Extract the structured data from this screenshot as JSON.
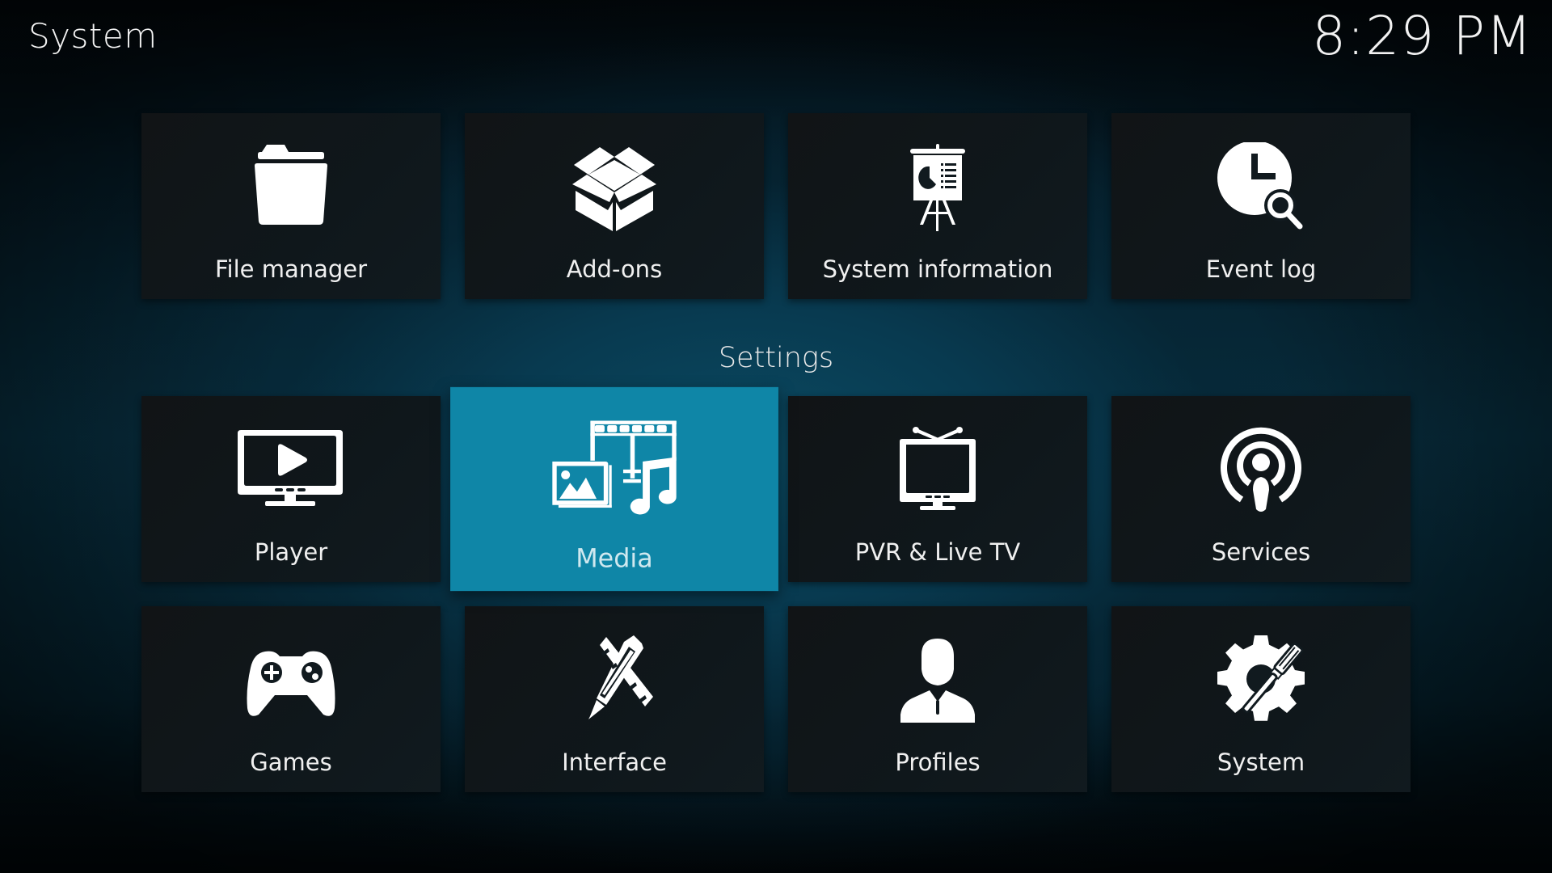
{
  "header": {
    "title": "System",
    "clock": "8:29 PM"
  },
  "top_row": [
    {
      "label": "File manager",
      "icon": "folder-icon"
    },
    {
      "label": "Add-ons",
      "icon": "open-box-icon"
    },
    {
      "label": "System information",
      "icon": "presentation-easel-icon"
    },
    {
      "label": "Event log",
      "icon": "clock-search-icon"
    }
  ],
  "settings": {
    "section_label": "Settings",
    "focused_item": "Media",
    "items": [
      {
        "label": "Player",
        "icon": "monitor-play-icon"
      },
      {
        "label": "Media",
        "icon": "media-collage-icon"
      },
      {
        "label": "PVR & Live TV",
        "icon": "tv-antenna-icon"
      },
      {
        "label": "Services",
        "icon": "podcast-broadcast-icon"
      },
      {
        "label": "Games",
        "icon": "gamepad-icon"
      },
      {
        "label": "Interface",
        "icon": "ruler-pencil-icon"
      },
      {
        "label": "Profiles",
        "icon": "person-icon"
      },
      {
        "label": "System",
        "icon": "gear-screwdriver-icon"
      }
    ]
  },
  "colors": {
    "focus_accent": "#0f86a7",
    "tile_background": "#111a1f",
    "text": "#f0f0f0"
  }
}
